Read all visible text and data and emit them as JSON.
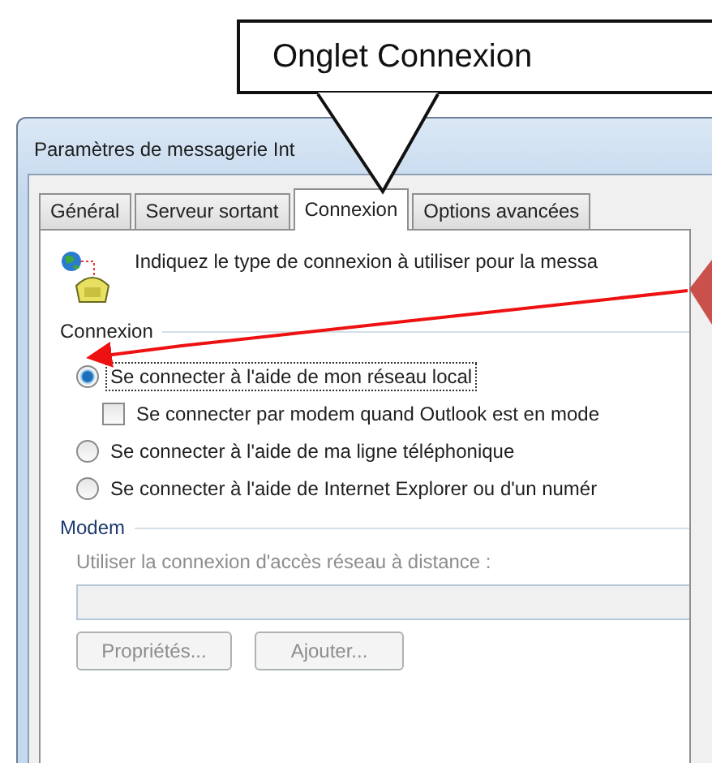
{
  "callout": {
    "text": "Onglet Connexion"
  },
  "window": {
    "title": "Paramètres de messagerie Int"
  },
  "tabs": [
    {
      "label": "Général",
      "selected": false
    },
    {
      "label": "Serveur sortant",
      "selected": false
    },
    {
      "label": "Connexion",
      "selected": true
    },
    {
      "label": "Options avancées",
      "selected": false
    }
  ],
  "description": "Indiquez le type de connexion à utiliser pour la messa",
  "connection_group": {
    "label": "Connexion",
    "options": [
      {
        "kind": "radio",
        "label": "Se connecter à l'aide de mon réseau local",
        "selected": true,
        "focused": true
      },
      {
        "kind": "checkbox",
        "label": "Se connecter par modem quand Outlook est en mode",
        "checked": false
      },
      {
        "kind": "radio",
        "label": "Se connecter à l'aide de ma ligne téléphonique",
        "selected": false
      },
      {
        "kind": "radio",
        "label": "Se connecter à l'aide de Internet Explorer ou d'un numér",
        "selected": false
      }
    ]
  },
  "modem_group": {
    "label": "Modem",
    "field_label": "Utiliser la connexion d'accès réseau à distance :",
    "field": {
      "disabled": true
    },
    "buttons": [
      {
        "label": "Propriétés...",
        "disabled": true
      },
      {
        "label": "Ajouter...",
        "disabled": true
      }
    ]
  }
}
